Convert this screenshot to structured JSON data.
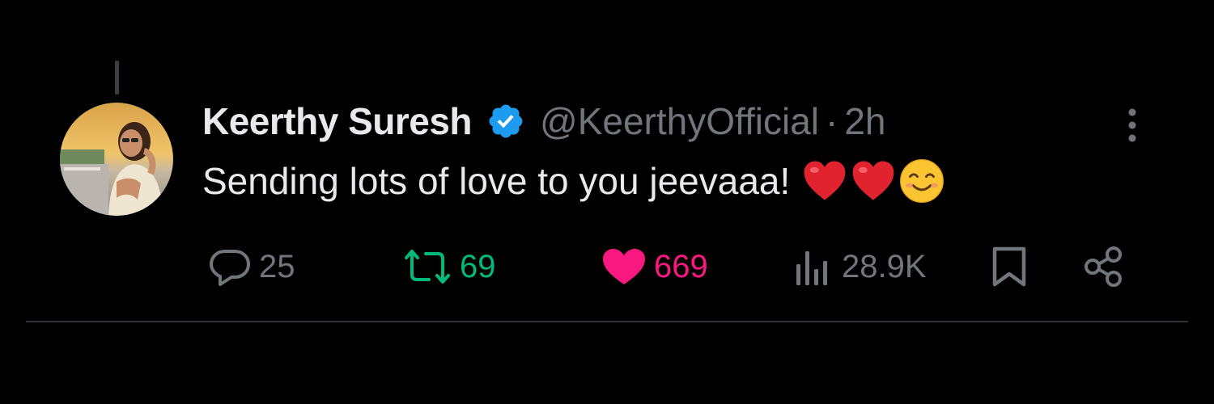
{
  "tweet": {
    "display_name": "Keerthy Suresh",
    "handle": "@KeerthyOfficial",
    "separator": "·",
    "time": "2h",
    "text": "Sending lots of love to you jeevaaa!",
    "emojis": [
      "red-heart-emoji",
      "red-heart-emoji",
      "smiling-face-emoji"
    ],
    "verified": true
  },
  "actions": {
    "replies": "25",
    "retweets": "69",
    "likes": "669",
    "views": "28.9K"
  },
  "colors": {
    "background": "#000000",
    "text_primary": "#e7e9ea",
    "text_secondary": "#71767b",
    "verified_blue": "#1d9bf0",
    "retweet_green": "#00ba7c",
    "like_pink": "#f91880",
    "divider": "#2f3336"
  },
  "icons": {
    "reply": "reply-bubble-icon",
    "retweet": "retweet-arrows-icon",
    "like": "heart-filled-icon",
    "views": "analytics-bars-icon",
    "bookmark": "bookmark-icon",
    "share": "share-nodes-icon",
    "more": "more-vertical-icon",
    "verified": "verified-badge-icon"
  }
}
